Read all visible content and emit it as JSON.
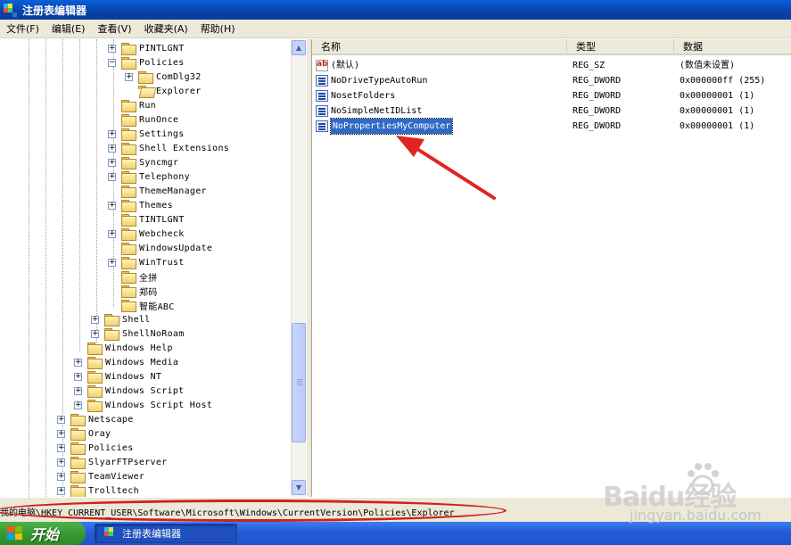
{
  "window": {
    "title": "注册表编辑器"
  },
  "menu": [
    {
      "label": "文件(F)"
    },
    {
      "label": "编辑(E)"
    },
    {
      "label": "查看(V)"
    },
    {
      "label": "收藏夹(A)"
    },
    {
      "label": "帮助(H)"
    }
  ],
  "tree": [
    {
      "label": "PINTLGNT",
      "expander": "+"
    },
    {
      "label": "Policies",
      "expander": "-"
    },
    {
      "label": "ComDlg32",
      "expander": "+"
    },
    {
      "label": "Explorer",
      "expander": "",
      "open": true
    },
    {
      "label": "Run",
      "expander": ""
    },
    {
      "label": "RunOnce",
      "expander": ""
    },
    {
      "label": "Settings",
      "expander": "+"
    },
    {
      "label": "Shell Extensions",
      "expander": "+"
    },
    {
      "label": "Syncmgr",
      "expander": "+"
    },
    {
      "label": "Telephony",
      "expander": "+"
    },
    {
      "label": "ThemeManager",
      "expander": ""
    },
    {
      "label": "Themes",
      "expander": "+"
    },
    {
      "label": "TINTLGNT",
      "expander": ""
    },
    {
      "label": "Webcheck",
      "expander": "+"
    },
    {
      "label": "WindowsUpdate",
      "expander": ""
    },
    {
      "label": "WinTrust",
      "expander": "+"
    },
    {
      "label": "全拼",
      "expander": ""
    },
    {
      "label": "郑码",
      "expander": ""
    },
    {
      "label": "智能ABC",
      "expander": ""
    },
    {
      "label": "Shell",
      "expander": "+"
    },
    {
      "label": "ShellNoRoam",
      "expander": "+"
    },
    {
      "label": "Windows Help",
      "expander": ""
    },
    {
      "label": "Windows Media",
      "expander": "+"
    },
    {
      "label": "Windows NT",
      "expander": "+"
    },
    {
      "label": "Windows Script",
      "expander": "+"
    },
    {
      "label": "Windows Script Host",
      "expander": "+"
    },
    {
      "label": "Netscape",
      "expander": "+"
    },
    {
      "label": "Oray",
      "expander": "+"
    },
    {
      "label": "Policies",
      "expander": "+"
    },
    {
      "label": "SlyarFTPserver",
      "expander": "+"
    },
    {
      "label": "TeamViewer",
      "expander": "+"
    },
    {
      "label": "Trolltech",
      "expander": "+"
    }
  ],
  "columns": {
    "name": "名称",
    "type": "类型",
    "data": "数据"
  },
  "values": [
    {
      "name": "(默认)",
      "type": "REG_SZ",
      "data": "(数值未设置)",
      "icon": "string-value-icon"
    },
    {
      "name": "NoDriveTypeAutoRun",
      "type": "REG_DWORD",
      "data": "0x000000ff (255)",
      "icon": "dword-value-icon"
    },
    {
      "name": "NosetFolders",
      "type": "REG_DWORD",
      "data": "0x00000001 (1)",
      "icon": "dword-value-icon"
    },
    {
      "name": "NoSimpleNetIDList",
      "type": "REG_DWORD",
      "data": "0x00000001 (1)",
      "icon": "dword-value-icon"
    },
    {
      "name": "NoPropertiesMyComputer",
      "type": "REG_DWORD",
      "data": "0x00000001 (1)",
      "icon": "dword-value-icon",
      "selected": true
    }
  ],
  "status": {
    "path": "我的电脑\\HKEY_CURRENT_USER\\Software\\Microsoft\\Windows\\CurrentVersion\\Policies\\Explorer"
  },
  "taskbar": {
    "start_label": "开始",
    "task_label": "注册表编辑器"
  },
  "watermark": {
    "brand": "Baidu经验",
    "url": "jingyan.baidu.com"
  },
  "colors": {
    "titlebar": "#0a4fc4",
    "selection": "#316ac5",
    "annotation": "#d31f1f",
    "start": "#379a32"
  }
}
